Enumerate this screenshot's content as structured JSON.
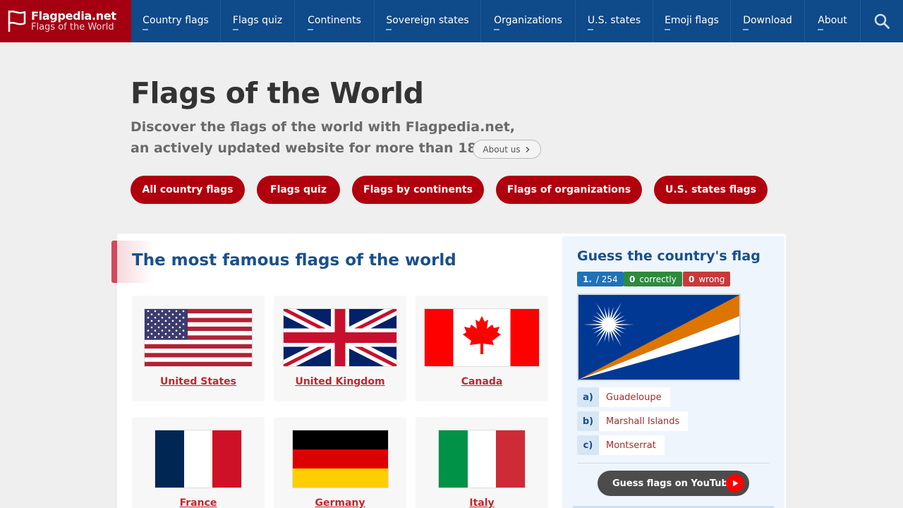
{
  "brand": {
    "name": "Flagpedia.net",
    "tagline": "Flags of the World"
  },
  "nav": {
    "items": [
      {
        "label": "Country flags"
      },
      {
        "label": "Flags quiz"
      },
      {
        "label": "Continents"
      },
      {
        "label": "Sovereign states"
      },
      {
        "label": "Organizations"
      },
      {
        "label": "U.S. states"
      },
      {
        "label": "Emoji flags"
      },
      {
        "label": "Download"
      },
      {
        "label": "About"
      }
    ],
    "search_icon": "search-icon"
  },
  "hero": {
    "title": "Flags of the World",
    "line1": "Discover the flags of the world with Flagpedia.net,",
    "line2": "an actively updated website for more than 18 years.",
    "about_label": "About us"
  },
  "quick_links": [
    {
      "label": "All country flags"
    },
    {
      "label": "Flags quiz"
    },
    {
      "label": "Flags by continents"
    },
    {
      "label": "Flags of organizations"
    },
    {
      "label": "U.S. states flags"
    }
  ],
  "famous": {
    "title": "The most famous flags of the world",
    "flags": [
      {
        "name": "United States"
      },
      {
        "name": "United Kingdom"
      },
      {
        "name": "Canada"
      },
      {
        "name": "France"
      },
      {
        "name": "Germany"
      },
      {
        "name": "Italy"
      }
    ]
  },
  "quiz": {
    "title": "Guess the country's flag",
    "question_number": "1.",
    "question_total": "/ 254",
    "correct_count": "0",
    "correct_label": "correctly",
    "wrong_count": "0",
    "wrong_label": "wrong",
    "answers": [
      {
        "letter": "a)",
        "text": "Guadeloupe"
      },
      {
        "letter": "b)",
        "text": "Marshall Islands"
      },
      {
        "letter": "c)",
        "text": "Montserrat"
      }
    ],
    "youtube_label": "Guess flags on YouTube!"
  },
  "colors": {
    "brand_red": "#a50012",
    "nav_blue": "#0f4a8a",
    "button_red": "#b0000e",
    "link_red": "#c0282e",
    "heading_blue": "#1a4f8a"
  }
}
